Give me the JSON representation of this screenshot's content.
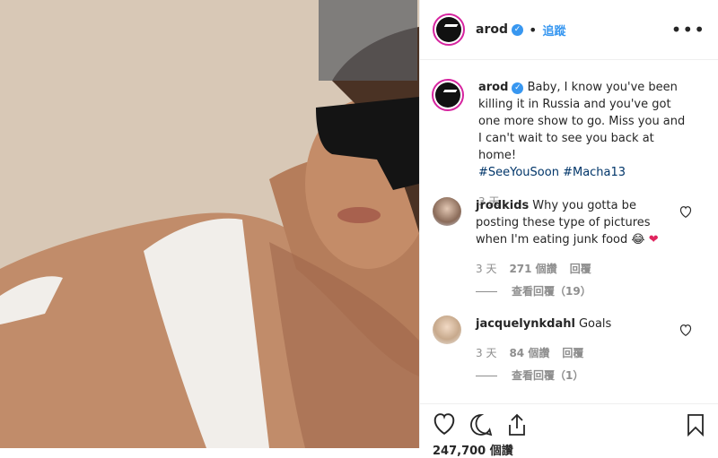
{
  "post": {
    "username": "arod",
    "follow_label": "追蹤",
    "more_icon": "more-icon",
    "caption": "Baby, I know you've been killing it in Russia and you've got one more show to go. Miss you and I can't wait to see you back at home!",
    "hashtags": "#SeeYouSoon #Macha13",
    "time": "3 天"
  },
  "comments": [
    {
      "username": "jrodkids",
      "text": "Why you gotta be posting these type of pictures when I'm eating junk food 😂",
      "heart": "❤",
      "time": "3 天",
      "likes": "271 個讚",
      "reply": "回覆",
      "view_replies": "查看回覆（19）"
    },
    {
      "username": "jacquelynkdahl",
      "text": "Goals",
      "time": "3 天",
      "likes": "84 個讚",
      "reply": "回覆",
      "view_replies": "查看回覆（1）"
    }
  ],
  "likes_total": "247,700 個讚"
}
